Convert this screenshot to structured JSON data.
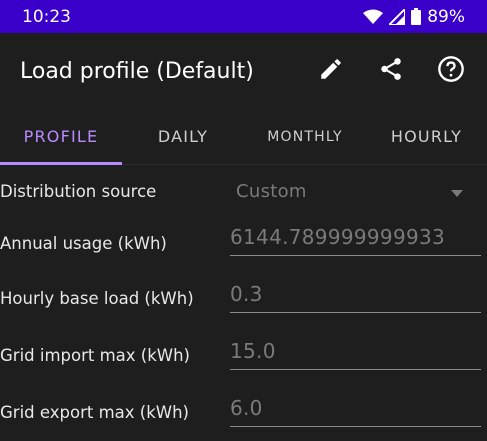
{
  "status": {
    "time": "10:23",
    "battery": "89%"
  },
  "appbar": {
    "title": "Load profile (Default)",
    "icons": [
      "edit-icon",
      "share-icon",
      "help-icon"
    ]
  },
  "tabs": [
    {
      "label": "PROFILE",
      "active": true
    },
    {
      "label": "DAILY",
      "active": false
    },
    {
      "label": "MONTHLY",
      "active": false
    },
    {
      "label": "HOURLY",
      "active": false
    }
  ],
  "form": {
    "distribution": {
      "label": "Distribution source",
      "value": "Custom"
    },
    "annual": {
      "label": "Annual usage (kWh)",
      "value": "6144.789999999933"
    },
    "base": {
      "label": "Hourly base load (kWh)",
      "value": "0.3"
    },
    "import": {
      "label": "Grid import max (kWh)",
      "value": "15.0"
    },
    "export": {
      "label": "Grid export max (kWh)",
      "value": "6.0"
    }
  },
  "colors": {
    "status_bar": "#3a00c9",
    "accent": "#b98bff",
    "background": "#1e1e1e"
  }
}
